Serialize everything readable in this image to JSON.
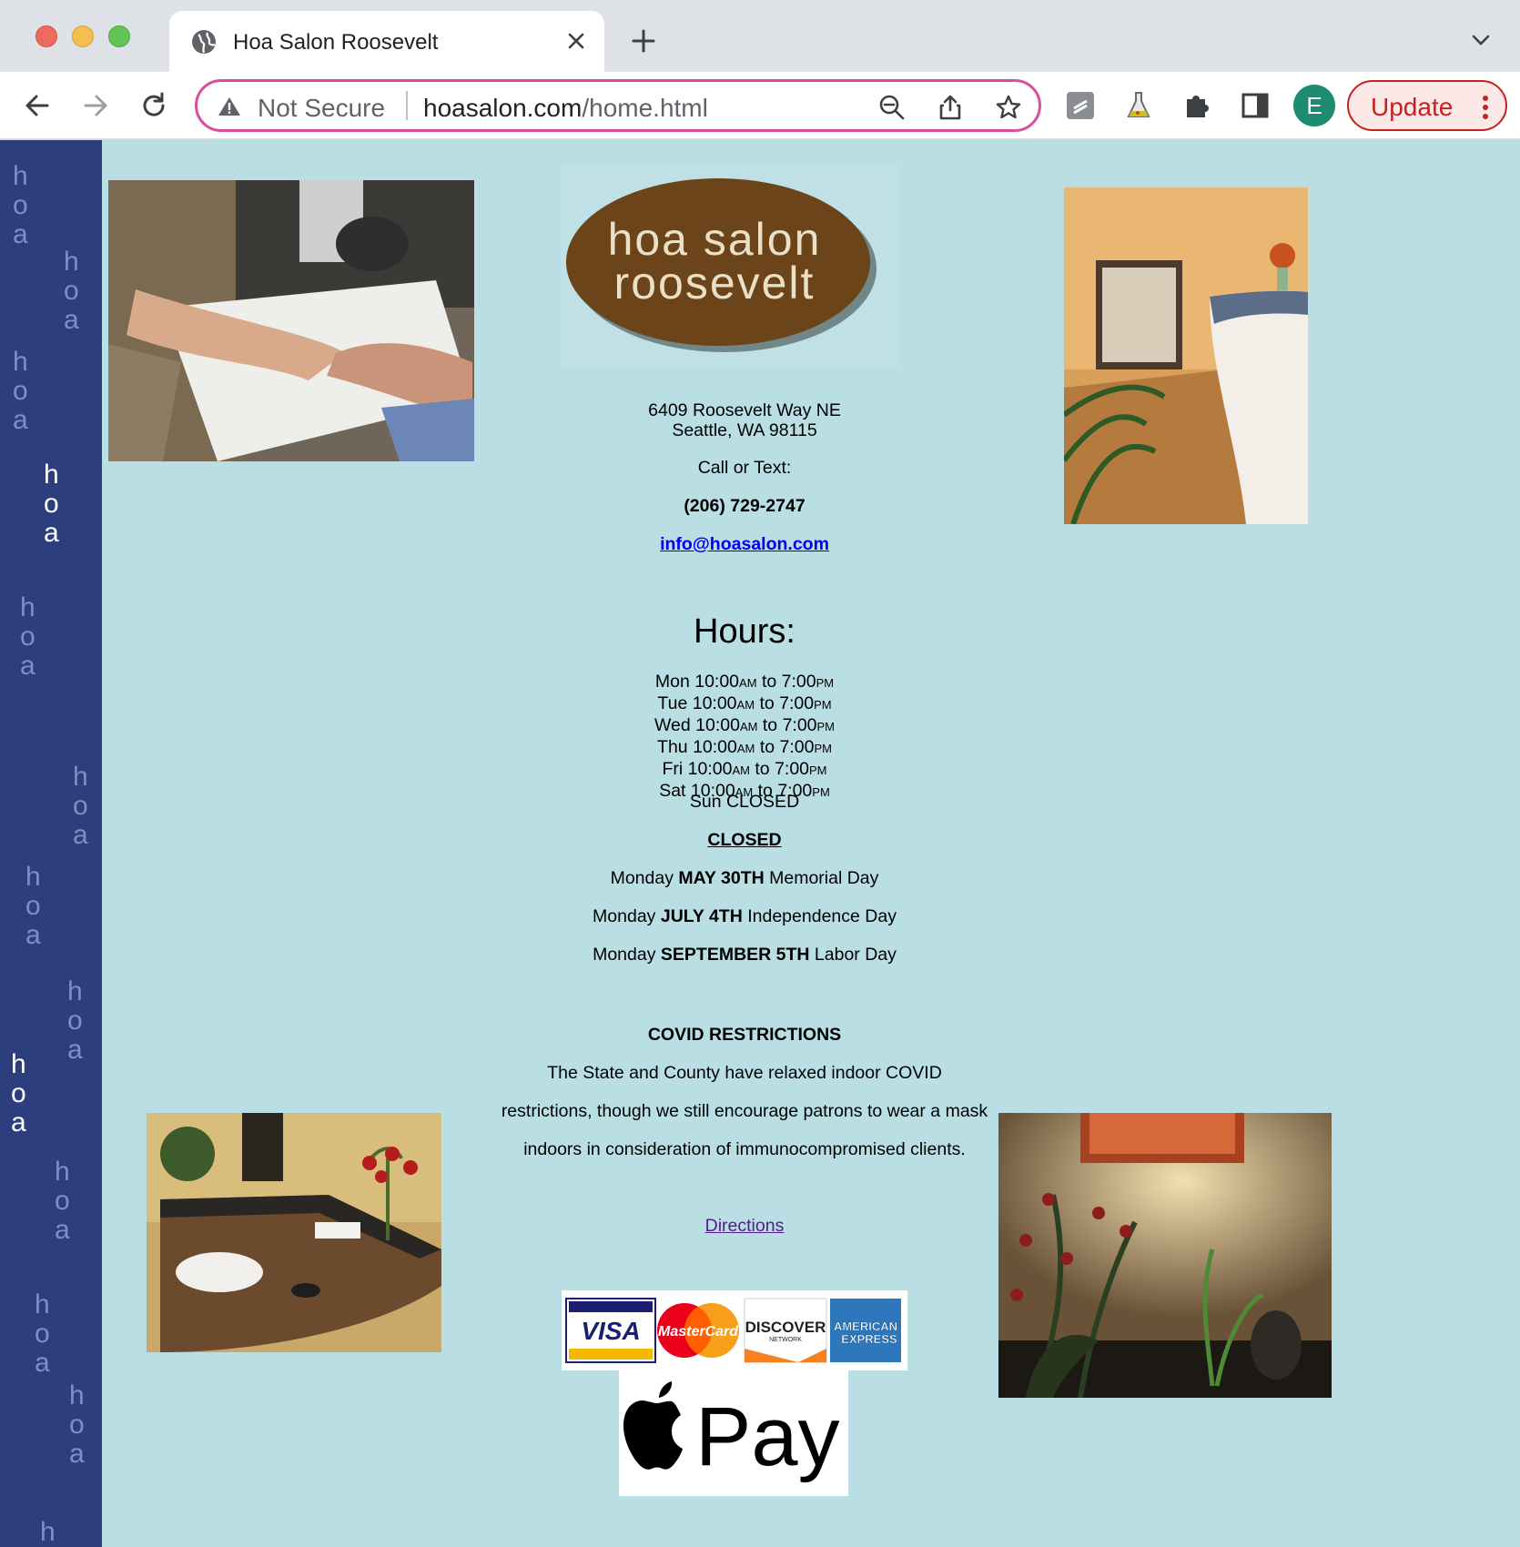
{
  "browser": {
    "tab_title": "Hoa Salon Roosevelt",
    "security_label": "Not Secure",
    "url_domain": "hoasalon.com",
    "url_path": "/home.html",
    "profile_initial": "E",
    "update_label": "Update"
  },
  "sidebar": {
    "watermark": [
      "h",
      "o",
      "a"
    ]
  },
  "logo": {
    "line1": "hoa salon",
    "line2": "roosevelt"
  },
  "contact": {
    "address_line1": "6409 Roosevelt Way NE",
    "address_line2": "Seattle, WA 98115",
    "call_label": "Call or Text:",
    "phone": "(206) 729-2747",
    "email": "info@hoasalon.com"
  },
  "hours": {
    "title": "Hours:",
    "rows": [
      {
        "day": "Mon",
        "open": "10:00",
        "open_suffix": "AM",
        "to": "to",
        "close": "7:00",
        "close_suffix": "PM"
      },
      {
        "day": "Tue",
        "open": "10:00",
        "open_suffix": "AM",
        "to": "to",
        "close": "7:00",
        "close_suffix": "PM"
      },
      {
        "day": "Wed",
        "open": "10:00",
        "open_suffix": "AM",
        "to": "to",
        "close": "7:00",
        "close_suffix": "PM"
      },
      {
        "day": "Thu",
        "open": "10:00",
        "open_suffix": "AM",
        "to": "to",
        "close": "7:00",
        "close_suffix": "PM"
      },
      {
        "day": "Fri",
        "open": "10:00",
        "open_suffix": "AM",
        "to": "to",
        "close": "7:00",
        "close_suffix": "PM"
      },
      {
        "day": "Sat",
        "open": "10:00",
        "open_suffix": "AM",
        "to": "to",
        "close": "7:00",
        "close_suffix": "PM"
      }
    ],
    "sunday": "Sun CLOSED"
  },
  "closures": {
    "heading": "CLOSED",
    "items": [
      {
        "prefix": "Monday",
        "date": "MAY 30TH",
        "holiday": "Memorial Day"
      },
      {
        "prefix": "Monday",
        "date": "JULY 4TH",
        "holiday": "Independence Day"
      },
      {
        "prefix": "Monday",
        "date": "SEPTEMBER 5TH",
        "holiday": "Labor Day"
      }
    ]
  },
  "covid": {
    "heading": "COVID RESTRICTIONS",
    "line1": "The State and County have relaxed indoor COVID",
    "line2": "restrictions, though we still encourage patrons to wear a mask",
    "line3": "indoors in consideration of immunocompromised clients."
  },
  "directions_label": "Directions",
  "payment": {
    "visa": "VISA",
    "mastercard": "MasterCard",
    "discover": "DISCOVER",
    "discover_sub": "NETWORK",
    "amex_line1": "AMERICAN",
    "amex_line2": "EXPRESS",
    "applepay": "Pay"
  },
  "colors": {
    "page_bg": "#b9dfe4",
    "sidebar_bg": "#2c3e7e",
    "logo_brown": "#6b4419",
    "link": "#0000ee",
    "visited_link": "#551a8b"
  }
}
